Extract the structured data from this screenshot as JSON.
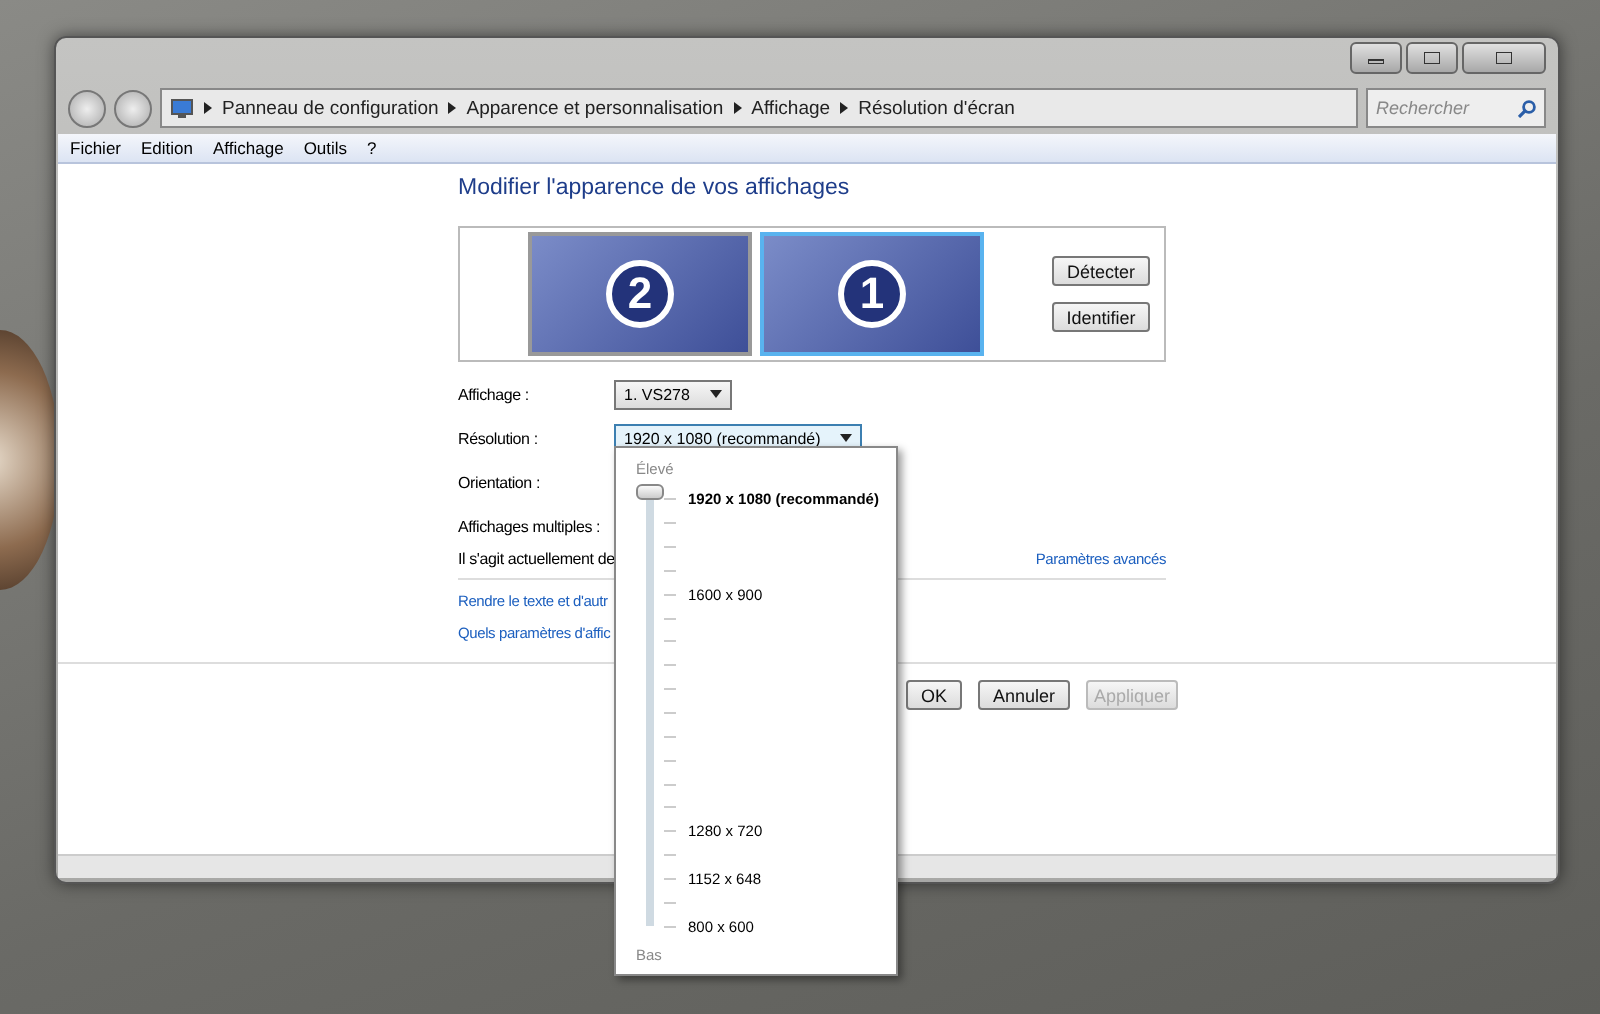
{
  "address_bar": {
    "crumbs": [
      "Panneau de configuration",
      "Apparence et personnalisation",
      "Affichage",
      "Résolution d'écran"
    ],
    "search_placeholder": "Rechercher"
  },
  "menu": [
    "Fichier",
    "Edition",
    "Affichage",
    "Outils",
    "?"
  ],
  "heading": "Modifier l'apparence de vos affichages",
  "monitors": [
    {
      "number": "2",
      "selected": false
    },
    {
      "number": "1",
      "selected": true
    }
  ],
  "side_buttons": [
    "Détecter",
    "Identifier"
  ],
  "fields": [
    {
      "label": "Affichage :",
      "value": "1. VS278",
      "kind": "dropdown",
      "open": false
    },
    {
      "label": "Résolution :",
      "value": "1920 x 1080 (recommandé)",
      "kind": "dropdown",
      "open": true
    },
    {
      "label": "Orientation :",
      "kind": "covered"
    },
    {
      "label": "Affichages multiples :",
      "kind": "covered"
    }
  ],
  "info_text": "Il s'agit actuellement de",
  "advanced_link": "Paramètres avancés",
  "links": [
    "Rendre le texte et d'autr",
    "Quels paramètres d'affic"
  ],
  "buttons": [
    {
      "label": "OK",
      "disabled": false
    },
    {
      "label": "Annuler",
      "disabled": false
    },
    {
      "label": "Appliquer",
      "disabled": true
    }
  ],
  "resolution_popup": {
    "top_label": "Élevé",
    "bottom_label": "Bas",
    "level": 1,
    "options": [
      {
        "label": "1920 x 1080 (recommandé)",
        "selected": true
      },
      {
        "label": "1600 x 900",
        "selected": false
      },
      {
        "label": "1280 x 720",
        "selected": false
      },
      {
        "label": "1152 x 648",
        "selected": false
      },
      {
        "label": "800 x 600",
        "selected": false
      }
    ]
  }
}
